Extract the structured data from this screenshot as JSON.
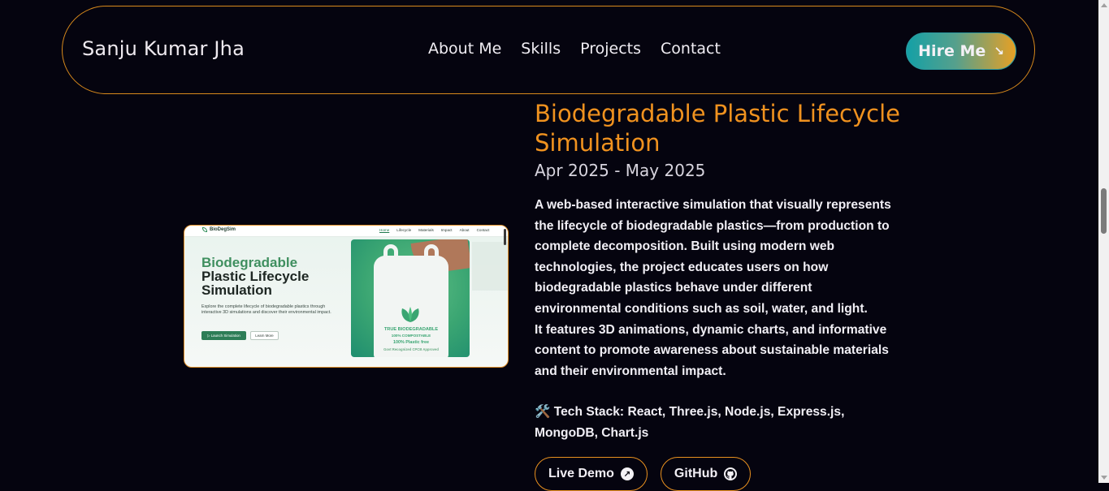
{
  "navbar": {
    "brand": "Sanju Kumar Jha",
    "links": [
      "About Me",
      "Skills",
      "Projects",
      "Contact"
    ],
    "hire_label": "Hire Me",
    "hire_arrow": "↘"
  },
  "project": {
    "title": "Biodegradable Plastic Lifecycle Simulation",
    "date": "Apr 2025 - May 2025",
    "description": [
      "A web-based interactive simulation that visually represents the lifecycle of biodegradable plastics—from production to complete decomposition. Built using modern web technologies, the project educates users on how biodegradable plastics behave under different environmental conditions such as soil, water, and light.",
      "It features 3D animations, dynamic charts, and informative content to promote awareness about sustainable materials and their environmental impact."
    ],
    "tech_stack": "🛠️ Tech Stack: React, Three.js, Node.js, Express.js, MongoDB, Chart.js",
    "live_demo_label": "Live Demo",
    "github_label": "GitHub"
  },
  "screenshot": {
    "logo": "BioDegSim",
    "nav": [
      "Home",
      "Lifecycle",
      "Materials",
      "Impact",
      "About",
      "Contact"
    ],
    "heading_green": "Biodegradable",
    "heading_line2": "Plastic Lifecycle",
    "heading_line3": "Simulation",
    "desc": "Explore the complete lifecycle of biodegradable plastics through interactive 3D simulations and discover their environmental impact.",
    "btn_primary": "▷ Launch Simulation",
    "btn_secondary": "Learn More",
    "bag_text": [
      "TRUE BIODEGRADABLE",
      "100% COMPOSTABLE",
      "100% Plastic free",
      "Govt Recognized CPCB Approved"
    ]
  },
  "colors": {
    "accent": "#f0921f",
    "background": "#05040f",
    "teal": "#14a0a6"
  }
}
